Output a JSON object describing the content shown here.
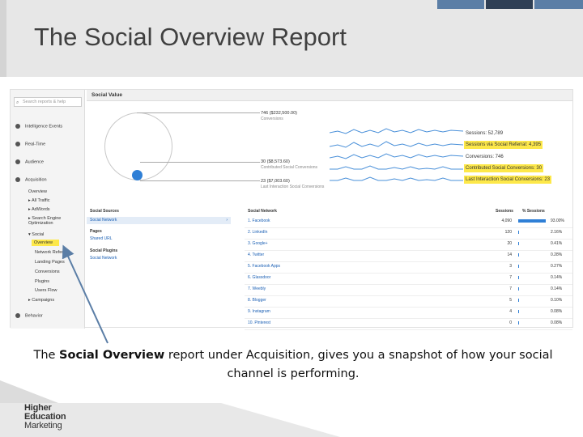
{
  "slide": {
    "title": "The Social Overview Report",
    "caption_pre": "The ",
    "caption_bold": "Social Overview",
    "caption_post": " report under Acquisition, gives you a snapshot of how your social channel is performing.",
    "logo_lines": [
      "Higher",
      "Education",
      "Marketing"
    ]
  },
  "colors": {
    "accent_blue": "#2f7fd6",
    "highlight": "#fde84a",
    "band": "#e7e7e7",
    "block_dark": "#2f3f55",
    "block_light": "#5b7ea6"
  },
  "sidebar": {
    "search_placeholder": "Search reports & help",
    "items": [
      {
        "label": "Intelligence Events",
        "icon": "bulb-icon"
      },
      {
        "label": "Real-Time",
        "icon": "clock-icon"
      },
      {
        "label": "Audience",
        "icon": "people-icon"
      },
      {
        "label": "Acquisition",
        "icon": "acquisition-icon"
      },
      {
        "label": "Overview"
      },
      {
        "label": "▸ All Traffic"
      },
      {
        "label": "▸ AdWords"
      },
      {
        "label": "▸ Search Engine Optimization"
      },
      {
        "label": "▾ Social"
      },
      {
        "label": "Overview"
      },
      {
        "label": "Network Referrals"
      },
      {
        "label": "Landing Pages"
      },
      {
        "label": "Conversions"
      },
      {
        "label": "Plugins"
      },
      {
        "label": "Users Flow"
      },
      {
        "label": "▸ Campaigns"
      },
      {
        "label": "Behavior",
        "icon": "behavior-icon"
      }
    ]
  },
  "main": {
    "header": "Social Value",
    "values": [
      {
        "big": "746 ($232,500.00)",
        "sub": "Conversions"
      },
      {
        "big": "30 ($8,573.60)",
        "sub": "Contributed Social Conversions"
      },
      {
        "big": "23 ($7,003.60)",
        "sub": "Last Interaction Social Conversions"
      }
    ],
    "metrics": [
      {
        "label": "Sessions: 52,789"
      },
      {
        "label": "Sessions via Social Referral: 4,395"
      },
      {
        "label": "Conversions: 746"
      },
      {
        "label": "Contributed Social Conversions: 30"
      },
      {
        "label": "Last Interaction Social Conversions: 23"
      }
    ]
  },
  "sources": {
    "header": "Social Sources",
    "selected": "Social Network",
    "groups": [
      {
        "title": "Pages",
        "link": "Shared URL"
      },
      {
        "title": "Social Plugins",
        "link": "Social Network"
      }
    ]
  },
  "network": {
    "headers": [
      "Social Network",
      "Sessions",
      "% Sessions"
    ],
    "rows": [
      {
        "name": "1. Facebook",
        "sessions": "4,090",
        "pct": "93.00%",
        "share": 0.93
      },
      {
        "name": "2. LinkedIn",
        "sessions": "120",
        "pct": "2.16%",
        "share": 0.0216
      },
      {
        "name": "3. Google+",
        "sessions": "20",
        "pct": "0.41%",
        "share": 0.0041
      },
      {
        "name": "4. Twitter",
        "sessions": "14",
        "pct": "0.28%",
        "share": 0.0028
      },
      {
        "name": "5. Facebook Apps",
        "sessions": "3",
        "pct": "0.27%",
        "share": 0.0027
      },
      {
        "name": "6. Glassdoor",
        "sessions": "7",
        "pct": "0.14%",
        "share": 0.0014
      },
      {
        "name": "7. Weebly",
        "sessions": "7",
        "pct": "0.14%",
        "share": 0.0014
      },
      {
        "name": "8. Blogger",
        "sessions": "5",
        "pct": "0.10%",
        "share": 0.001
      },
      {
        "name": "9. Instagram",
        "sessions": "4",
        "pct": "0.08%",
        "share": 0.0008
      },
      {
        "name": "10. Pinterest",
        "sessions": "0",
        "pct": "0.08%",
        "share": 0.0008
      }
    ]
  }
}
